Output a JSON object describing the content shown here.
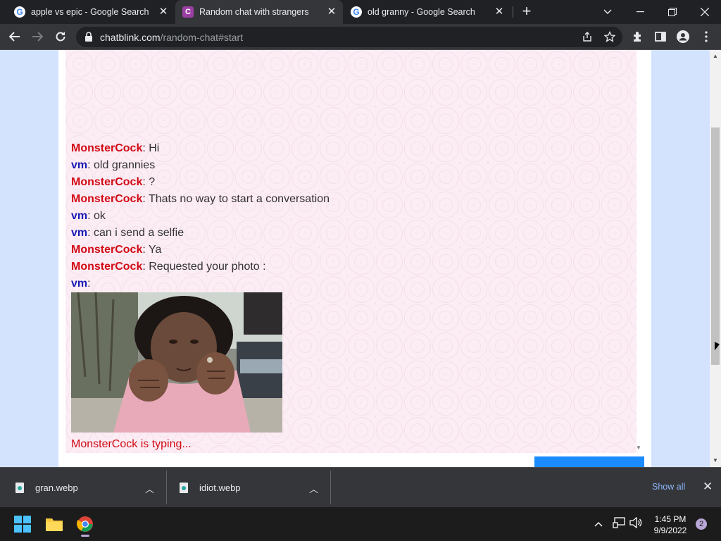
{
  "browser": {
    "tabs": [
      {
        "title": "apple vs epic - Google Search",
        "favicon": "google-icon",
        "active": false
      },
      {
        "title": "Random chat with strangers",
        "favicon": "chatblink-icon",
        "favicon_letter": "C",
        "active": true
      },
      {
        "title": "old granny - Google Search",
        "favicon": "google-icon",
        "active": false
      }
    ],
    "google_letter": "G",
    "new_tab_glyph": "+",
    "url_domain": "chatblink.com",
    "url_path": "/random-chat#start"
  },
  "chat": {
    "stranger_color": "#d10a14",
    "me_color": "#1a1ab5",
    "messages": [
      {
        "nick": "MonsterCock",
        "sep": ": ",
        "text": "Hi"
      },
      {
        "nick": "vm",
        "sep": ": ",
        "text": "old grannies"
      },
      {
        "nick": "MonsterCock",
        "sep": ": ",
        "text": "?"
      },
      {
        "nick": "MonsterCock",
        "sep": ": ",
        "text": "Thats no way to start a conversation"
      },
      {
        "nick": "vm",
        "sep": ": ",
        "text": "ok"
      },
      {
        "nick": "vm",
        "sep": ": ",
        "text": "can i send a selfie"
      },
      {
        "nick": "MonsterCock",
        "sep": ": ",
        "text": "Ya"
      },
      {
        "nick": "MonsterCock",
        "sep": ": ",
        "text": "Requested your photo :"
      },
      {
        "nick": "vm",
        "sep": ":",
        "text": ""
      }
    ],
    "typing_status": "MonsterCock is typing..."
  },
  "downloads": {
    "items": [
      {
        "filename": "gran.webp"
      },
      {
        "filename": "idiot.webp"
      }
    ],
    "show_all_label": "Show all"
  },
  "taskbar": {
    "time": "1:45 PM",
    "date": "9/9/2022",
    "notification_count": "2",
    "apps": [
      "windows-start-icon",
      "file-explorer-icon",
      "chrome-icon"
    ]
  }
}
